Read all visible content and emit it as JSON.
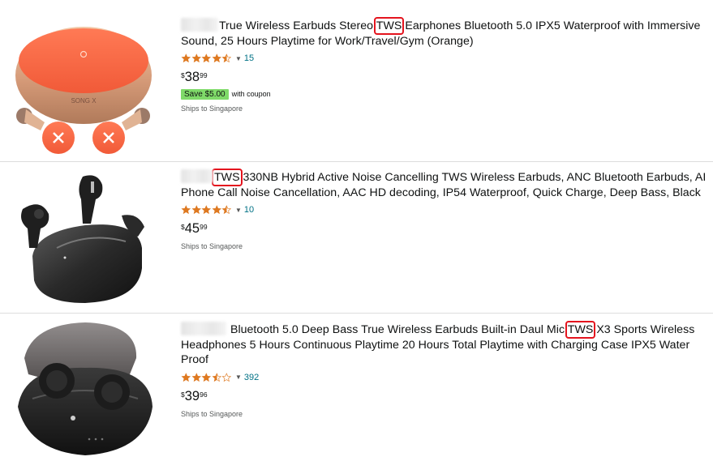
{
  "results": [
    {
      "title_pre": "True Wireless Earbuds Stereo ",
      "title_hl": "TWS",
      "title_post": " Earphones Bluetooth 5.0 IPX5 Waterproof with Immersive Sound, 25 Hours Playtime for Work/Travel/Gym (Orange)",
      "rating_stars": 4.5,
      "rating_count": "15",
      "price_symbol": "$",
      "price_whole": "38",
      "price_fraction": "99",
      "coupon_badge": "Save $5.00",
      "coupon_text": "with coupon",
      "shipping": "Ships to Singapore",
      "image_icon": "orange-earbuds-case-icon",
      "case_label": "SONG X"
    },
    {
      "title_pre": "",
      "title_hl": "TWS",
      "title_post": " 330NB Hybrid Active Noise Cancelling TWS Wireless Earbuds, ANC Bluetooth Earbuds, AI Phone Call Noise Cancellation, AAC HD decoding, IP54 Waterproof, Quick Charge, Deep Bass, Black",
      "rating_stars": 4.5,
      "rating_count": "10",
      "price_symbol": "$",
      "price_whole": "45",
      "price_fraction": "99",
      "shipping": "Ships to Singapore",
      "image_icon": "black-anc-earbuds-case-icon"
    },
    {
      "title_pre": " Bluetooth 5.0 Deep Bass True Wireless Earbuds Built-in Daul Mic ",
      "title_hl": "TWS",
      "title_post": " X3 Sports Wireless Headphones 5 Hours Continuous Playtime 20 Hours Total Playtime with Charging Case IPX5 Water Proof",
      "rating_stars": 3.5,
      "rating_count": "392",
      "price_symbol": "$",
      "price_whole": "39",
      "price_fraction": "96",
      "shipping": "Ships to Singapore",
      "image_icon": "black-round-earbuds-case-icon"
    }
  ],
  "colors": {
    "highlight_box": "#e4141e",
    "star_fill": "#de7921",
    "link": "#007185",
    "coupon_green": "#7fda69"
  }
}
